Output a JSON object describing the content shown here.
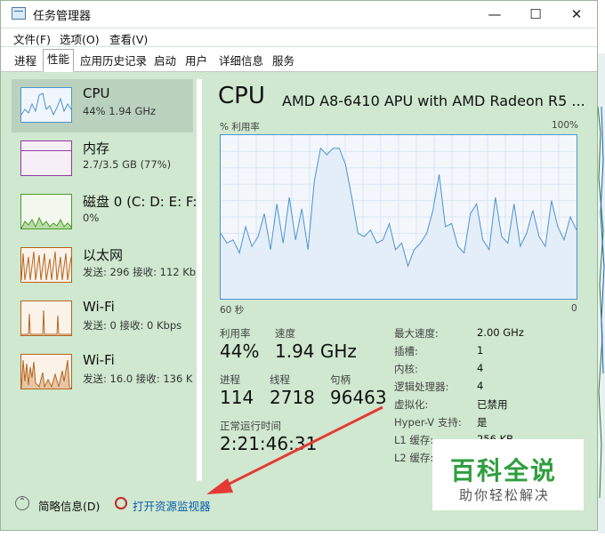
{
  "window": {
    "title": "任务管理器",
    "minimize": "—",
    "maximize": "☐",
    "close": "✕"
  },
  "menu": [
    "文件(F)",
    "选项(O)",
    "查看(V)"
  ],
  "tabs": [
    "进程",
    "性能",
    "应用历史记录",
    "启动",
    "用户",
    "详细信息",
    "服务"
  ],
  "active_tab": "性能",
  "sidebar": [
    {
      "name": "CPU",
      "sub": "44%  1.94 GHz",
      "selected": true
    },
    {
      "name": "内存",
      "sub": "2.7/3.5 GB (77%)"
    },
    {
      "name": "磁盘 0 (C: D: E: F:",
      "sub": "0%"
    },
    {
      "name": "以太网",
      "sub": "发送: 296  接收: 112 Kb"
    },
    {
      "name": "Wi-Fi",
      "sub": "发送: 0  接收: 0 Kbps"
    },
    {
      "name": "Wi-Fi",
      "sub": "发送: 16.0  接收: 136 K"
    }
  ],
  "panel": {
    "title": "CPU",
    "model": "AMD A8-6410 APU with AMD Radeon R5 ...",
    "graph_label": "% 利用率",
    "graph_max": "100%",
    "graph_time": "60 秒",
    "graph_min": "0"
  },
  "stats": {
    "util_label": "利用率",
    "util_value": "44%",
    "speed_label": "速度",
    "speed_value": "1.94 GHz",
    "proc_label": "进程",
    "proc_value": "114",
    "thread_label": "线程",
    "thread_value": "2718",
    "handle_label": "句柄",
    "handle_value": "96463",
    "uptime_label": "正常运行时间",
    "uptime_value": "2:21:46:31"
  },
  "specs": [
    {
      "label": "最大速度:",
      "value": "2.00 GHz"
    },
    {
      "label": "插槽:",
      "value": "1"
    },
    {
      "label": "内核:",
      "value": "4"
    },
    {
      "label": "逻辑处理器:",
      "value": "4"
    },
    {
      "label": "虚拟化:",
      "value": "已禁用"
    },
    {
      "label": "Hyper-V 支持:",
      "value": "是"
    },
    {
      "label": "L1 缓存:",
      "value": "256 KB"
    },
    {
      "label": "L2 缓存:",
      "value": ""
    }
  ],
  "footer": {
    "brief": "简略信息(D)",
    "resource_monitor": "打开资源监视器"
  },
  "watermark": {
    "main": "百科全说",
    "sub": "助你轻松解决"
  },
  "cpu_history": [
    0.4,
    0.34,
    0.36,
    0.28,
    0.44,
    0.32,
    0.38,
    0.52,
    0.3,
    0.58,
    0.34,
    0.62,
    0.36,
    0.55,
    0.3,
    0.72,
    0.92,
    0.88,
    0.92,
    0.92,
    0.82,
    0.62,
    0.4,
    0.38,
    0.42,
    0.34,
    0.36,
    0.46,
    0.3,
    0.34,
    0.2,
    0.3,
    0.34,
    0.4,
    0.54,
    0.76,
    0.44,
    0.46,
    0.32,
    0.28,
    0.52,
    0.58,
    0.36,
    0.3,
    0.62,
    0.38,
    0.34,
    0.58,
    0.32,
    0.4,
    0.54,
    0.38,
    0.32,
    0.6,
    0.44,
    0.36,
    0.5,
    0.42
  ],
  "colors": {
    "accent": "#4b94cf",
    "window_bg": "#cfe8cf",
    "selected_bg": "#b9d1bd",
    "arrow": "#e53935",
    "link": "#0b5cad"
  }
}
